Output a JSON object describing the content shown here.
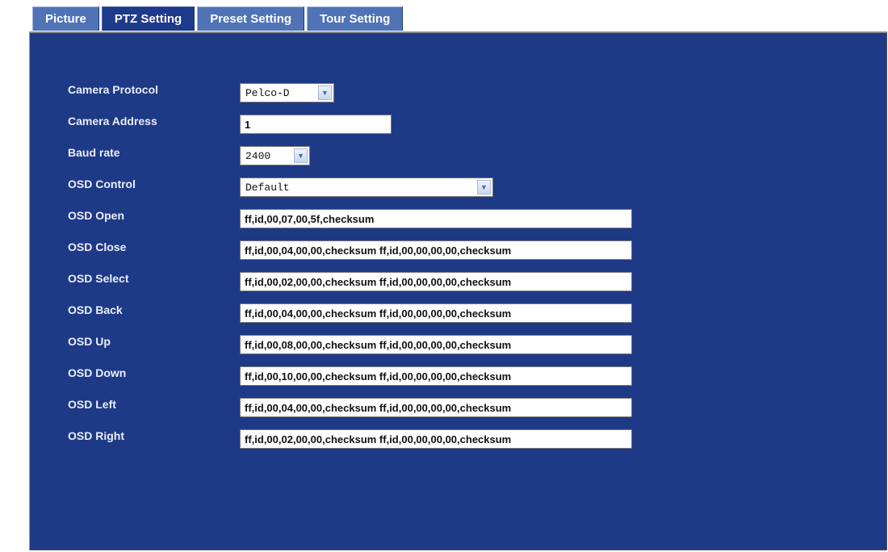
{
  "tabs": [
    {
      "label": "Picture"
    },
    {
      "label": "PTZ Setting"
    },
    {
      "label": "Preset Setting"
    },
    {
      "label": "Tour Setting"
    }
  ],
  "active_tab": "PTZ Setting",
  "form": {
    "camera_protocol": {
      "label": "Camera Protocol",
      "value": "Pelco-D"
    },
    "camera_address": {
      "label": "Camera Address",
      "value": "1"
    },
    "baud_rate": {
      "label": "Baud rate",
      "value": "2400"
    },
    "osd_control": {
      "label": "OSD Control",
      "value": "Default"
    },
    "osd_open": {
      "label": "OSD Open",
      "value": "ff,id,00,07,00,5f,checksum"
    },
    "osd_close": {
      "label": "OSD Close",
      "value": "ff,id,00,04,00,00,checksum ff,id,00,00,00,00,checksum"
    },
    "osd_select": {
      "label": "OSD Select",
      "value": "ff,id,00,02,00,00,checksum ff,id,00,00,00,00,checksum"
    },
    "osd_back": {
      "label": "OSD Back",
      "value": "ff,id,00,04,00,00,checksum ff,id,00,00,00,00,checksum"
    },
    "osd_up": {
      "label": "OSD Up",
      "value": "ff,id,00,08,00,00,checksum ff,id,00,00,00,00,checksum"
    },
    "osd_down": {
      "label": "OSD Down",
      "value": "ff,id,00,10,00,00,checksum ff,id,00,00,00,00,checksum"
    },
    "osd_left": {
      "label": "OSD Left",
      "value": "ff,id,00,04,00,00,checksum ff,id,00,00,00,00,checksum"
    },
    "osd_right": {
      "label": "OSD Right",
      "value": "ff,id,00,02,00,00,checksum ff,id,00,00,00,00,checksum"
    }
  },
  "colors": {
    "panel_bg": "#1e3a86",
    "tab_bg": "#4f73b5",
    "tab_active_bg": "#1e3a8a",
    "label_text": "#e9eef8"
  },
  "icons": {
    "dropdown": "chevron-down-icon"
  }
}
